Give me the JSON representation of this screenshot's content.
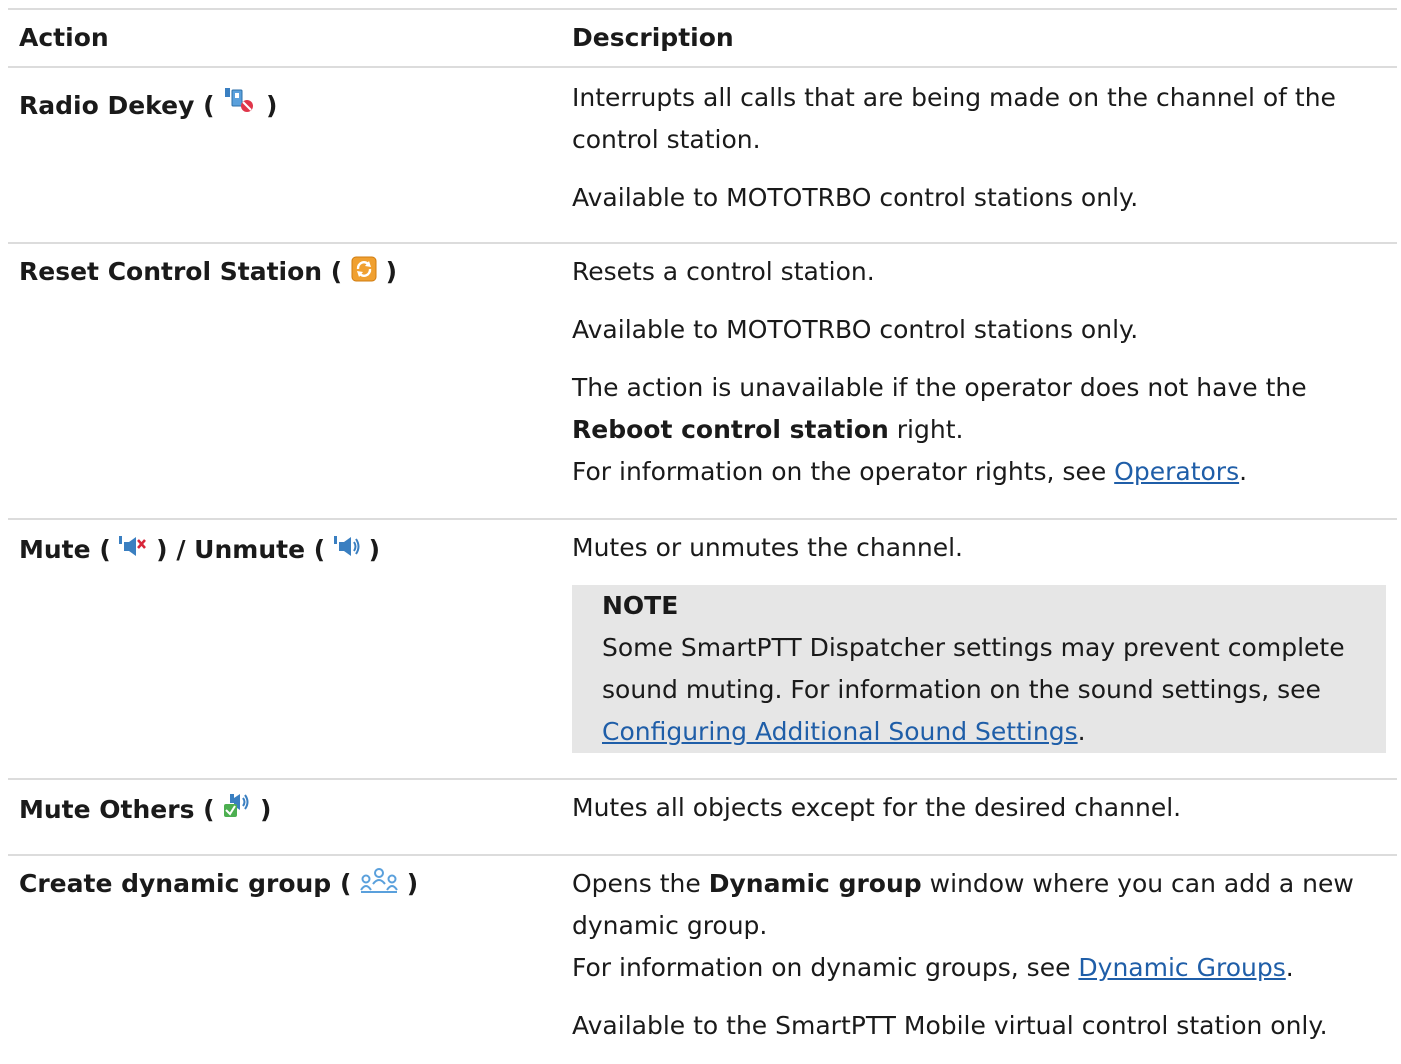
{
  "header": {
    "action": "Action",
    "description": "Description"
  },
  "rows": [
    {
      "action": "Radio Dekey",
      "icon": "radio-dekey-icon",
      "desc": [
        "Interrupts all calls that are being made on the channel of the control station.",
        "Available to MOTOTRBO control stations only."
      ]
    },
    {
      "action": "Reset Control Station",
      "icon": "reset-icon",
      "desc": [
        "Resets a control station.",
        "Available to MOTOTRBO control stations only."
      ],
      "right_pre": "The action is unavailable if the operator does not have the ",
      "right_bold": "Reboot control station",
      "right_post": " right.",
      "info_pre": "For information on the operator rights, see ",
      "info_link": "Operators",
      "info_post": "."
    },
    {
      "action_a": "Mute",
      "icon_a": "mute-speaker-icon",
      "sep": "/",
      "action_b": "Unmute",
      "icon_b": "speaker-icon",
      "desc": [
        "Mutes or unmutes the channel."
      ],
      "note_title": "NOTE",
      "note_text": "Some SmartPTT Dispatcher settings may prevent complete sound muting. For information on the sound settings, see ",
      "note_link": "Configuring Additional Sound Settings",
      "note_post": "."
    },
    {
      "action": "Mute Others",
      "icon": "mute-others-icon",
      "desc": [
        "Mutes all objects except for the desired channel."
      ]
    },
    {
      "action": "Create dynamic group",
      "icon": "dynamic-group-icon",
      "open_pre": "Opens the ",
      "open_bold": "Dynamic group",
      "open_post": " window where you can add a new dynamic group.",
      "info_pre": "For information on dynamic groups, see ",
      "info_link": "Dynamic Groups",
      "info_post": ".",
      "desc_last": "Available to the SmartPTT Mobile virtual control station only."
    }
  ],
  "colors": {
    "link": "#1f5ea8",
    "border": "#dcdcdc",
    "note_bg": "#e6e6e6"
  }
}
